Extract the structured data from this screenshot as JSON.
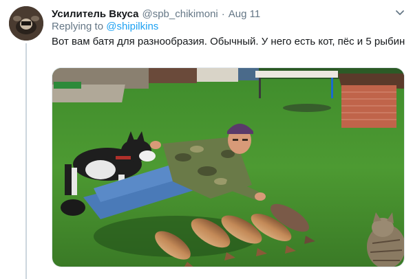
{
  "tweet": {
    "display_name": "Усилитель Вкуса",
    "handle": "@spb_chikimoni",
    "separator": "·",
    "date": "Aug 11",
    "replying_prefix": "Replying to",
    "replying_to": "@shipilkins",
    "text": "Вот вам батя для разнообразия. Обычный. У него есть кот, пёс и 5 рыбин"
  },
  "icons": {
    "caret": "chevron-down-icon"
  },
  "colors": {
    "link": "#1da1f2",
    "secondary_text": "#657786",
    "primary_text": "#14171a",
    "thread_line": "#ccd6dd"
  }
}
